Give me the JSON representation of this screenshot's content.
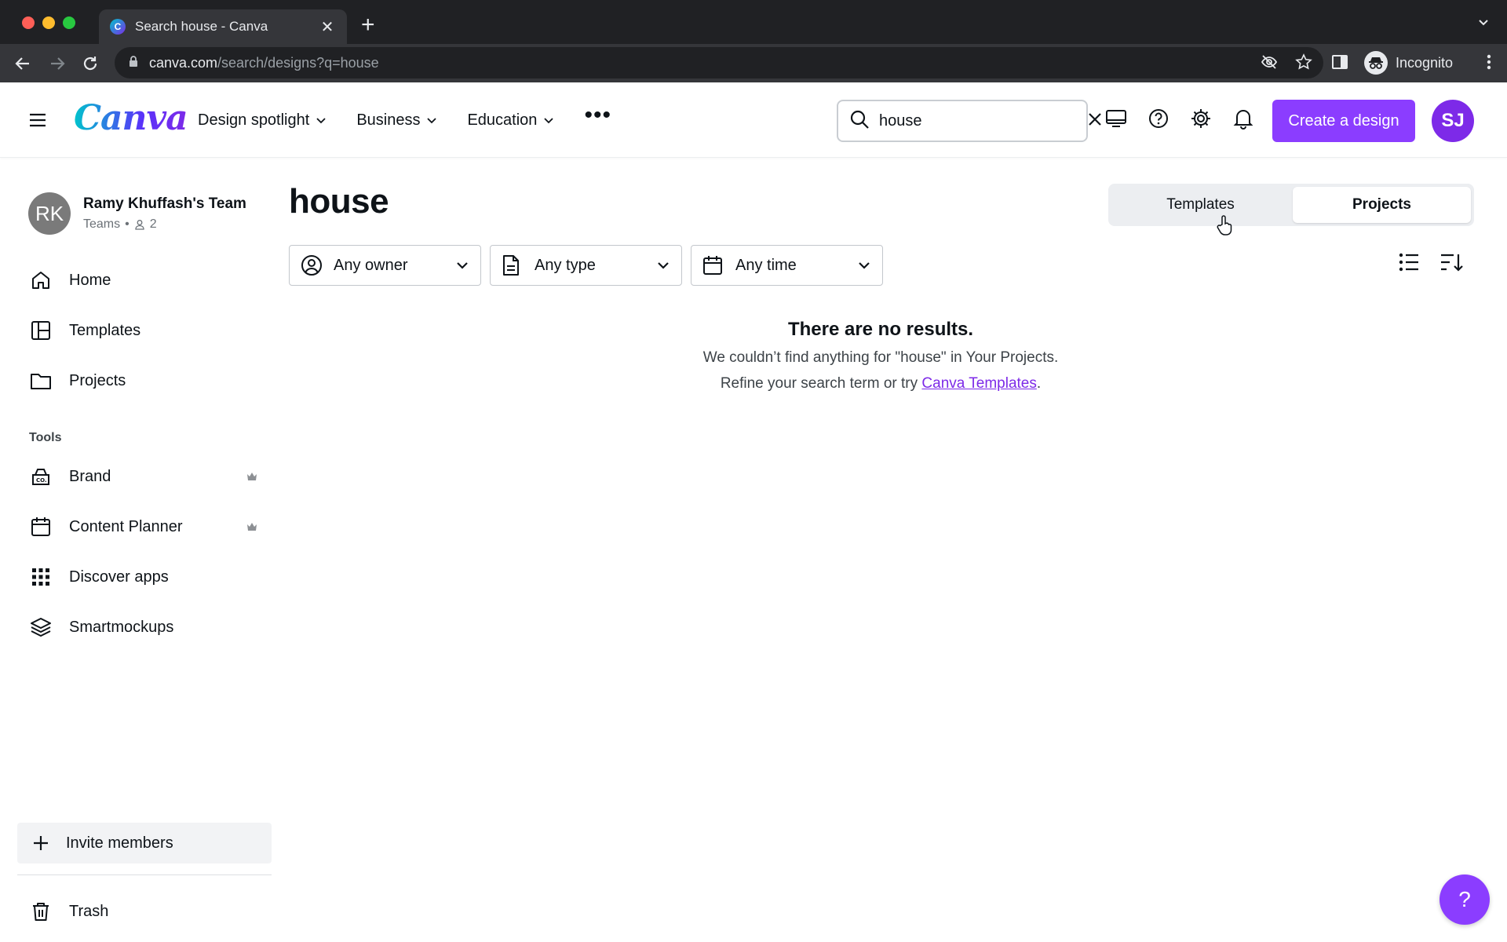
{
  "browser": {
    "tab_title": "Search house - Canva",
    "favicon_letter": "C",
    "url_host": "canva.com",
    "url_path": "/search/designs?q=house",
    "profile_label": "Incognito"
  },
  "header": {
    "logo": "Canva",
    "nav": [
      {
        "label": "Design spotlight"
      },
      {
        "label": "Business"
      },
      {
        "label": "Education"
      }
    ],
    "more": "•••",
    "search_value": "house",
    "create_label": "Create a design",
    "user_initials": "SJ"
  },
  "sidebar": {
    "team_initials": "RK",
    "team_name": "Ramy Khuffash's Team",
    "team_type": "Teams",
    "team_separator": "•",
    "member_count": "2",
    "items": [
      {
        "label": "Home",
        "icon": "home-icon"
      },
      {
        "label": "Templates",
        "icon": "templates-icon"
      },
      {
        "label": "Projects",
        "icon": "folder-icon"
      }
    ],
    "tools_label": "Tools",
    "tools": [
      {
        "label": "Brand",
        "icon": "brand-icon",
        "premium": true
      },
      {
        "label": "Content Planner",
        "icon": "calendar-icon",
        "premium": true
      },
      {
        "label": "Discover apps",
        "icon": "apps-grid-icon",
        "premium": false
      },
      {
        "label": "Smartmockups",
        "icon": "layers-icon",
        "premium": false
      }
    ],
    "invite_label": "Invite members",
    "trash_label": "Trash"
  },
  "main": {
    "title": "house",
    "tabs": [
      {
        "label": "Templates",
        "active": false
      },
      {
        "label": "Projects",
        "active": true
      }
    ],
    "filters": [
      {
        "label": "Any owner",
        "icon": "owner-icon"
      },
      {
        "label": "Any type",
        "icon": "document-icon"
      },
      {
        "label": "Any time",
        "icon": "calendar-icon"
      }
    ],
    "empty": {
      "title": "There are no results.",
      "line1": "We couldn’t find anything for \"house\" in Your Projects.",
      "line2_prefix": "Refine your search term or try ",
      "link": "Canva Templates",
      "line2_suffix": "."
    }
  },
  "help_fab": "?",
  "colors": {
    "brand_purple": "#8b3dff",
    "avatar_purple": "#7d2ae8",
    "team_avatar": "#7a7a7a"
  }
}
